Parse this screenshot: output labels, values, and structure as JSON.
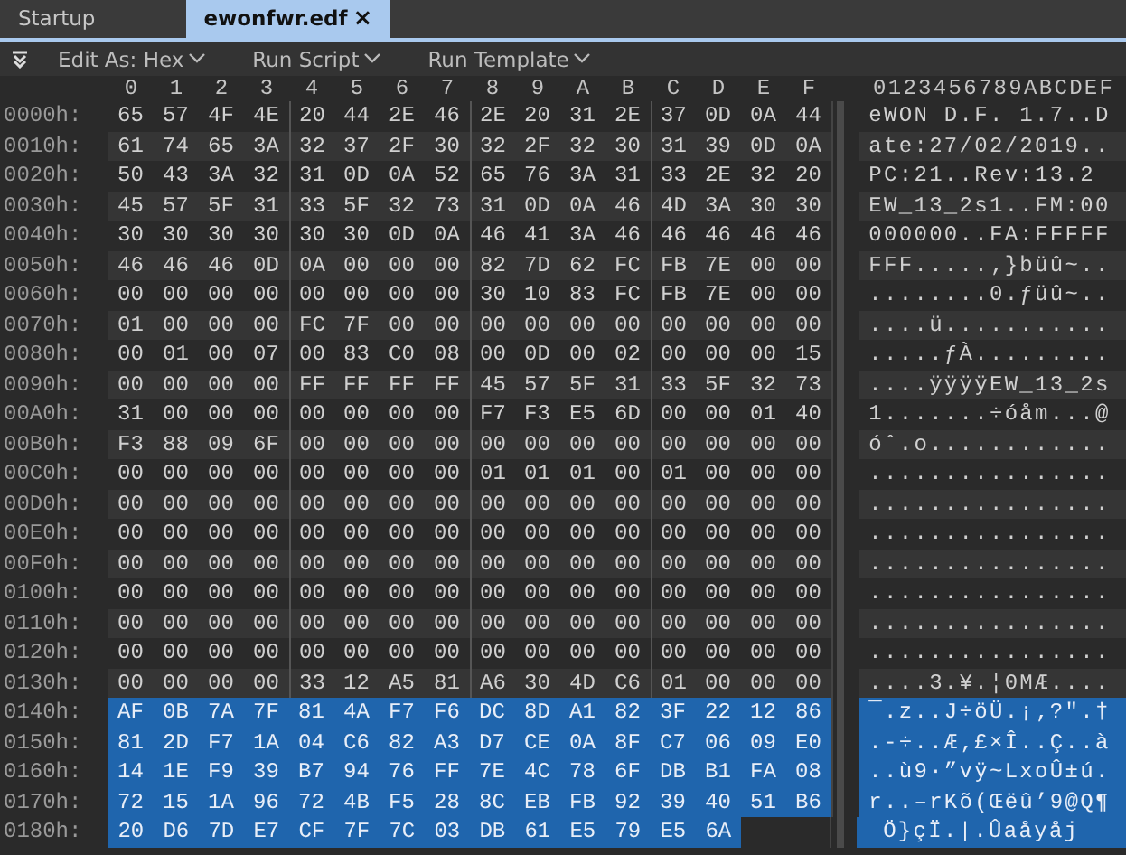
{
  "tabs": [
    {
      "label": "Startup",
      "selected": false
    },
    {
      "label": "ewonfwr.edf",
      "selected": true,
      "close": "×"
    }
  ],
  "toolbar": [
    "Edit As: Hex",
    "Run Script",
    "Run Template"
  ],
  "columns": [
    "0",
    "1",
    "2",
    "3",
    "4",
    "5",
    "6",
    "7",
    "8",
    "9",
    "A",
    "B",
    "C",
    "D",
    "E",
    "F"
  ],
  "ascii_header": "0123456789ABCDEF",
  "rows": [
    {
      "address": "0000h:",
      "bytes": [
        "65",
        "57",
        "4F",
        "4E",
        "20",
        "44",
        "2E",
        "46",
        "2E",
        "20",
        "31",
        "2E",
        "37",
        "0D",
        "0A",
        "44"
      ],
      "ascii": "eWON D.F. 1.7..D",
      "selected": false
    },
    {
      "address": "0010h:",
      "bytes": [
        "61",
        "74",
        "65",
        "3A",
        "32",
        "37",
        "2F",
        "30",
        "32",
        "2F",
        "32",
        "30",
        "31",
        "39",
        "0D",
        "0A"
      ],
      "ascii": "ate:27/02/2019..",
      "selected": false
    },
    {
      "address": "0020h:",
      "bytes": [
        "50",
        "43",
        "3A",
        "32",
        "31",
        "0D",
        "0A",
        "52",
        "65",
        "76",
        "3A",
        "31",
        "33",
        "2E",
        "32",
        "20"
      ],
      "ascii": "PC:21..Rev:13.2 ",
      "selected": false
    },
    {
      "address": "0030h:",
      "bytes": [
        "45",
        "57",
        "5F",
        "31",
        "33",
        "5F",
        "32",
        "73",
        "31",
        "0D",
        "0A",
        "46",
        "4D",
        "3A",
        "30",
        "30"
      ],
      "ascii": "EW_13_2s1..FM:00",
      "selected": false
    },
    {
      "address": "0040h:",
      "bytes": [
        "30",
        "30",
        "30",
        "30",
        "30",
        "30",
        "0D",
        "0A",
        "46",
        "41",
        "3A",
        "46",
        "46",
        "46",
        "46",
        "46"
      ],
      "ascii": "000000..FA:FFFFF",
      "selected": false
    },
    {
      "address": "0050h:",
      "bytes": [
        "46",
        "46",
        "46",
        "0D",
        "0A",
        "00",
        "00",
        "00",
        "82",
        "7D",
        "62",
        "FC",
        "FB",
        "7E",
        "00",
        "00"
      ],
      "ascii": "FFF.....‚}büû~..",
      "selected": false
    },
    {
      "address": "0060h:",
      "bytes": [
        "00",
        "00",
        "00",
        "00",
        "00",
        "00",
        "00",
        "00",
        "30",
        "10",
        "83",
        "FC",
        "FB",
        "7E",
        "00",
        "00"
      ],
      "ascii": "........0.ƒüû~..",
      "selected": false
    },
    {
      "address": "0070h:",
      "bytes": [
        "01",
        "00",
        "00",
        "00",
        "FC",
        "7F",
        "00",
        "00",
        "00",
        "00",
        "00",
        "00",
        "00",
        "00",
        "00",
        "00"
      ],
      "ascii": "....ü...........",
      "selected": false
    },
    {
      "address": "0080h:",
      "bytes": [
        "00",
        "01",
        "00",
        "07",
        "00",
        "83",
        "C0",
        "08",
        "00",
        "0D",
        "00",
        "02",
        "00",
        "00",
        "00",
        "15"
      ],
      "ascii": ".....ƒÀ.........",
      "selected": false
    },
    {
      "address": "0090h:",
      "bytes": [
        "00",
        "00",
        "00",
        "00",
        "FF",
        "FF",
        "FF",
        "FF",
        "45",
        "57",
        "5F",
        "31",
        "33",
        "5F",
        "32",
        "73"
      ],
      "ascii": "....ÿÿÿÿEW_13_2s",
      "selected": false
    },
    {
      "address": "00A0h:",
      "bytes": [
        "31",
        "00",
        "00",
        "00",
        "00",
        "00",
        "00",
        "00",
        "F7",
        "F3",
        "E5",
        "6D",
        "00",
        "00",
        "01",
        "40"
      ],
      "ascii": "1.......÷óåm...@",
      "selected": false
    },
    {
      "address": "00B0h:",
      "bytes": [
        "F3",
        "88",
        "09",
        "6F",
        "00",
        "00",
        "00",
        "00",
        "00",
        "00",
        "00",
        "00",
        "00",
        "00",
        "00",
        "00"
      ],
      "ascii": "óˆ.o............",
      "selected": false
    },
    {
      "address": "00C0h:",
      "bytes": [
        "00",
        "00",
        "00",
        "00",
        "00",
        "00",
        "00",
        "00",
        "01",
        "01",
        "01",
        "00",
        "01",
        "00",
        "00",
        "00"
      ],
      "ascii": "................",
      "selected": false
    },
    {
      "address": "00D0h:",
      "bytes": [
        "00",
        "00",
        "00",
        "00",
        "00",
        "00",
        "00",
        "00",
        "00",
        "00",
        "00",
        "00",
        "00",
        "00",
        "00",
        "00"
      ],
      "ascii": "................",
      "selected": false
    },
    {
      "address": "00E0h:",
      "bytes": [
        "00",
        "00",
        "00",
        "00",
        "00",
        "00",
        "00",
        "00",
        "00",
        "00",
        "00",
        "00",
        "00",
        "00",
        "00",
        "00"
      ],
      "ascii": "................",
      "selected": false
    },
    {
      "address": "00F0h:",
      "bytes": [
        "00",
        "00",
        "00",
        "00",
        "00",
        "00",
        "00",
        "00",
        "00",
        "00",
        "00",
        "00",
        "00",
        "00",
        "00",
        "00"
      ],
      "ascii": "................",
      "selected": false
    },
    {
      "address": "0100h:",
      "bytes": [
        "00",
        "00",
        "00",
        "00",
        "00",
        "00",
        "00",
        "00",
        "00",
        "00",
        "00",
        "00",
        "00",
        "00",
        "00",
        "00"
      ],
      "ascii": "................",
      "selected": false
    },
    {
      "address": "0110h:",
      "bytes": [
        "00",
        "00",
        "00",
        "00",
        "00",
        "00",
        "00",
        "00",
        "00",
        "00",
        "00",
        "00",
        "00",
        "00",
        "00",
        "00"
      ],
      "ascii": "................",
      "selected": false
    },
    {
      "address": "0120h:",
      "bytes": [
        "00",
        "00",
        "00",
        "00",
        "00",
        "00",
        "00",
        "00",
        "00",
        "00",
        "00",
        "00",
        "00",
        "00",
        "00",
        "00"
      ],
      "ascii": "................",
      "selected": false
    },
    {
      "address": "0130h:",
      "bytes": [
        "00",
        "00",
        "00",
        "00",
        "33",
        "12",
        "A5",
        "81",
        "A6",
        "30",
        "4D",
        "C6",
        "01",
        "00",
        "00",
        "00"
      ],
      "ascii": "....3.¥.¦0MÆ....",
      "selected": false
    },
    {
      "address": "0140h:",
      "bytes": [
        "AF",
        "0B",
        "7A",
        "7F",
        "81",
        "4A",
        "F7",
        "F6",
        "DC",
        "8D",
        "A1",
        "82",
        "3F",
        "22",
        "12",
        "86"
      ],
      "ascii": "¯.z..J÷öÜ.¡‚?\".†",
      "selected": true
    },
    {
      "address": "0150h:",
      "bytes": [
        "81",
        "2D",
        "F7",
        "1A",
        "04",
        "C6",
        "82",
        "A3",
        "D7",
        "CE",
        "0A",
        "8F",
        "C7",
        "06",
        "09",
        "E0"
      ],
      "ascii": ".-÷..Æ‚£×Î..Ç..à",
      "selected": true
    },
    {
      "address": "0160h:",
      "bytes": [
        "14",
        "1E",
        "F9",
        "39",
        "B7",
        "94",
        "76",
        "FF",
        "7E",
        "4C",
        "78",
        "6F",
        "DB",
        "B1",
        "FA",
        "08"
      ],
      "ascii": "..ù9·”vÿ~LxoÛ±ú.",
      "selected": true
    },
    {
      "address": "0170h:",
      "bytes": [
        "72",
        "15",
        "1A",
        "96",
        "72",
        "4B",
        "F5",
        "28",
        "8C",
        "EB",
        "FB",
        "92",
        "39",
        "40",
        "51",
        "B6"
      ],
      "ascii": "r..–rKõ(Œëû’9@Q¶",
      "selected": true
    },
    {
      "address": "0180h:",
      "bytes": [
        "20",
        "D6",
        "7D",
        "E7",
        "CF",
        "7F",
        "7C",
        "03",
        "DB",
        "61",
        "E5",
        "79",
        "E5",
        "6A"
      ],
      "ascii": " Ö}çÏ.|.Ûaåyåj",
      "selected": true
    }
  ]
}
